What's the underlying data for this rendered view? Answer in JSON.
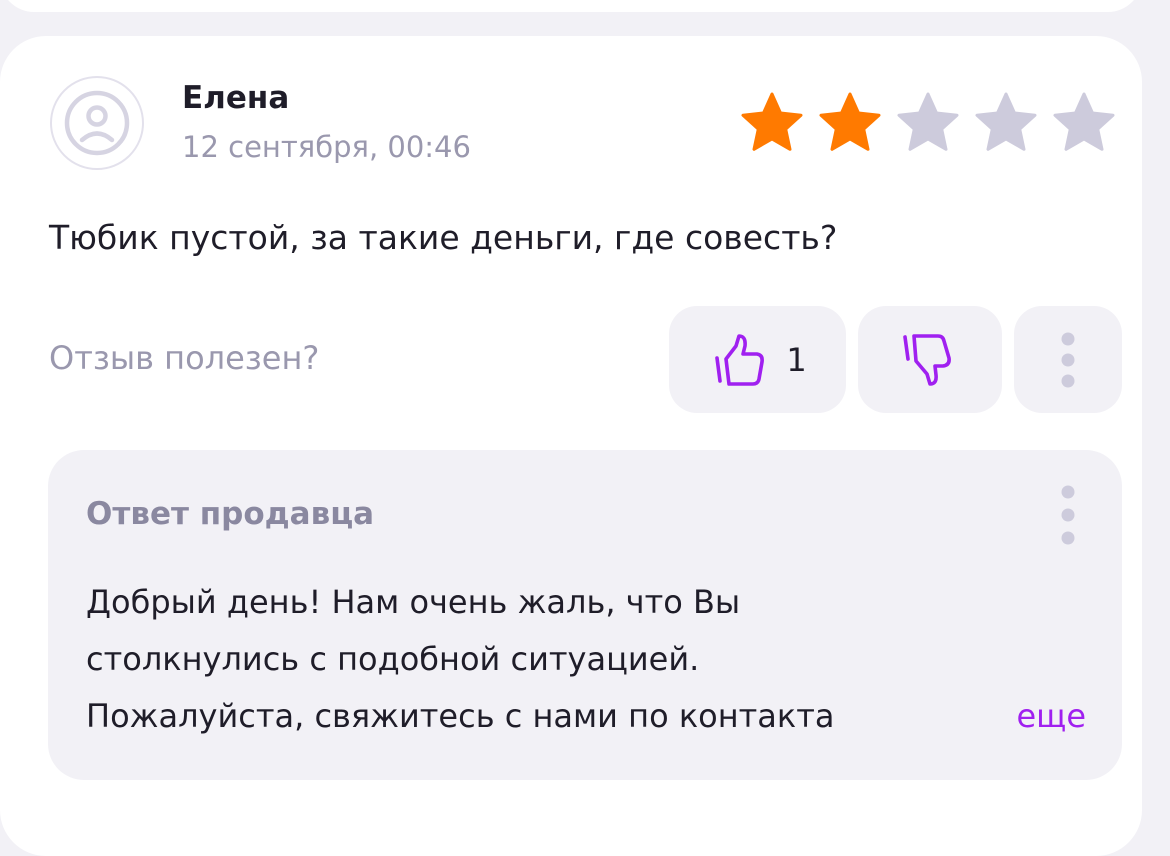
{
  "review": {
    "author": "Елена",
    "date": "12 сентября, 00:46",
    "rating": 2,
    "max_rating": 5,
    "text": "Тюбик пустой, за такие деньги, где совесть?"
  },
  "feedback": {
    "question": "Отзыв полезен?",
    "likes": "1"
  },
  "seller_reply": {
    "title": "Ответ продавца",
    "lines": [
      "Добрый день! Нам очень жаль, что Вы",
      "столкнулись с подобной ситуацией.",
      "Пожалуйста, свяжитесь с нами по контакта"
    ],
    "more_label": "еще"
  },
  "colors": {
    "star_filled": "#ff7a00",
    "star_empty": "#cdcbdc",
    "accent": "#a020f0",
    "muted_text": "#9a98ae"
  },
  "icons": {
    "avatar": "sad-face-icon",
    "like": "thumbs-up-icon",
    "dislike": "thumbs-down-icon",
    "more": "more-vertical-icon"
  }
}
